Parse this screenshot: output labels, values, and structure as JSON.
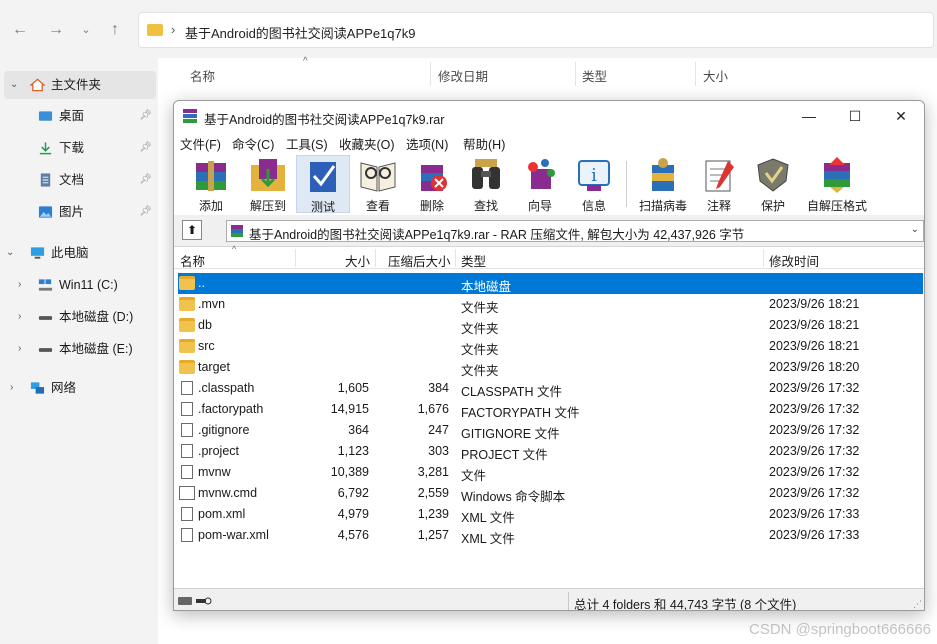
{
  "explorer": {
    "path": "基于Android的图书社交阅读APPe1q7k9",
    "sidebar": [
      {
        "label": "主文件夹",
        "icon": "home-icon"
      },
      {
        "label": "桌面",
        "icon": "desktop-icon"
      },
      {
        "label": "下载",
        "icon": "download-icon"
      },
      {
        "label": "文档",
        "icon": "document-icon"
      },
      {
        "label": "图片",
        "icon": "pictures-icon"
      },
      {
        "label": "此电脑",
        "icon": "computer-icon"
      },
      {
        "label": "Win11 (C:)",
        "icon": "windows-drive-icon"
      },
      {
        "label": "本地磁盘 (D:)",
        "icon": "drive-icon"
      },
      {
        "label": "本地磁盘 (E:)",
        "icon": "drive-icon"
      },
      {
        "label": "网络",
        "icon": "network-icon"
      }
    ],
    "columns": [
      "名称",
      "修改日期",
      "类型",
      "大小"
    ]
  },
  "rar": {
    "title": "基于Android的图书社交阅读APPe1q7k9.rar",
    "menu": [
      "文件(F)",
      "命令(C)",
      "工具(S)",
      "收藏夹(O)",
      "选项(N)",
      "帮助(H)"
    ],
    "toolbar": [
      "添加",
      "解压到",
      "测试",
      "查看",
      "删除",
      "查找",
      "向导",
      "信息",
      "扫描病毒",
      "注释",
      "保护",
      "自解压格式"
    ],
    "address": "基于Android的图书社交阅读APPe1q7k9.rar - RAR 压缩文件, 解包大小为 42,437,926 字节",
    "columns": [
      "名称",
      "大小",
      "压缩后大小",
      "类型",
      "修改时间"
    ],
    "rows": [
      {
        "name": "..",
        "size": "",
        "packed": "",
        "type": "本地磁盘",
        "modified": "",
        "kind": "folder"
      },
      {
        "name": ".mvn",
        "size": "",
        "packed": "",
        "type": "文件夹",
        "modified": "2023/9/26 18:21",
        "kind": "folder"
      },
      {
        "name": "db",
        "size": "",
        "packed": "",
        "type": "文件夹",
        "modified": "2023/9/26 18:21",
        "kind": "folder"
      },
      {
        "name": "src",
        "size": "",
        "packed": "",
        "type": "文件夹",
        "modified": "2023/9/26 18:21",
        "kind": "folder"
      },
      {
        "name": "target",
        "size": "",
        "packed": "",
        "type": "文件夹",
        "modified": "2023/9/26 18:20",
        "kind": "folder"
      },
      {
        "name": ".classpath",
        "size": "1,605",
        "packed": "384",
        "type": "CLASSPATH 文件",
        "modified": "2023/9/26 17:32",
        "kind": "file"
      },
      {
        "name": ".factorypath",
        "size": "14,915",
        "packed": "1,676",
        "type": "FACTORYPATH 文件",
        "modified": "2023/9/26 17:32",
        "kind": "file"
      },
      {
        "name": ".gitignore",
        "size": "364",
        "packed": "247",
        "type": "GITIGNORE 文件",
        "modified": "2023/9/26 17:32",
        "kind": "file"
      },
      {
        "name": ".project",
        "size": "1,123",
        "packed": "303",
        "type": "PROJECT 文件",
        "modified": "2023/9/26 17:32",
        "kind": "file"
      },
      {
        "name": "mvnw",
        "size": "10,389",
        "packed": "3,281",
        "type": "文件",
        "modified": "2023/9/26 17:32",
        "kind": "file"
      },
      {
        "name": "mvnw.cmd",
        "size": "6,792",
        "packed": "2,559",
        "type": "Windows 命令脚本",
        "modified": "2023/9/26 17:32",
        "kind": "cmd"
      },
      {
        "name": "pom.xml",
        "size": "4,979",
        "packed": "1,239",
        "type": "XML 文件",
        "modified": "2023/9/26 17:33",
        "kind": "file"
      },
      {
        "name": "pom-war.xml",
        "size": "4,576",
        "packed": "1,257",
        "type": "XML 文件",
        "modified": "2023/9/26 17:33",
        "kind": "file"
      }
    ],
    "status": "总计 4 folders 和 44,743 字节 (8 个文件)"
  },
  "watermark": "CSDN @springboot666666"
}
